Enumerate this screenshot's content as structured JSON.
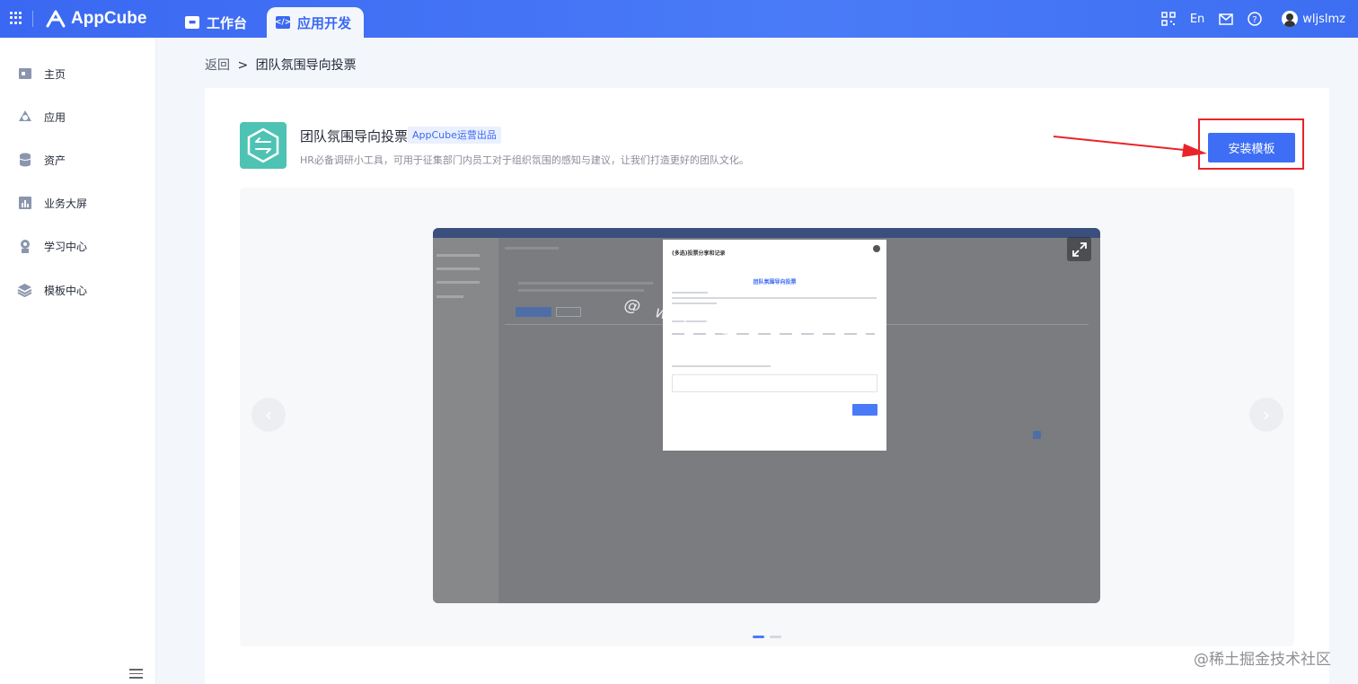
{
  "header": {
    "brand": "AppCube",
    "tabs": [
      {
        "label": "工作台",
        "icon": "monitor-icon",
        "active": false
      },
      {
        "label": "应用开发",
        "icon": "code-icon",
        "active": true
      }
    ],
    "language": "En",
    "user": "wljslmz",
    "icons": [
      "qrcode-icon",
      "mail-icon",
      "help-icon"
    ],
    "accent": "#3a68f2"
  },
  "sidebar": {
    "items": [
      {
        "label": "主页",
        "icon": "home-icon"
      },
      {
        "label": "应用",
        "icon": "app-icon"
      },
      {
        "label": "资产",
        "icon": "database-icon"
      },
      {
        "label": "业务大屏",
        "icon": "chart-icon"
      },
      {
        "label": "学习中心",
        "icon": "learning-icon"
      },
      {
        "label": "模板中心",
        "icon": "layers-icon"
      }
    ]
  },
  "breadcrumb": {
    "back": "返回",
    "separator": ">",
    "current": "团队氛围导向投票"
  },
  "template": {
    "name": "团队氛围导向投票",
    "badge": "AppCube运营出品",
    "description": "HR必备调研小工具，可用于征集部门内员工对于组织氛围的感知与建议，让我们打造更好的团队文化。",
    "install_label": "安装模板",
    "install_color": "#3e6ef5",
    "highlight_color": "#e8242a"
  },
  "preview": {
    "modal_title": "(多选)投票分享和记录",
    "modal_heading": "团队氛围导向投票",
    "watermark": "@ w l j s l m z",
    "slides_total": 2,
    "slide_active": 1
  },
  "corner_watermark": "@稀土掘金技术社区"
}
